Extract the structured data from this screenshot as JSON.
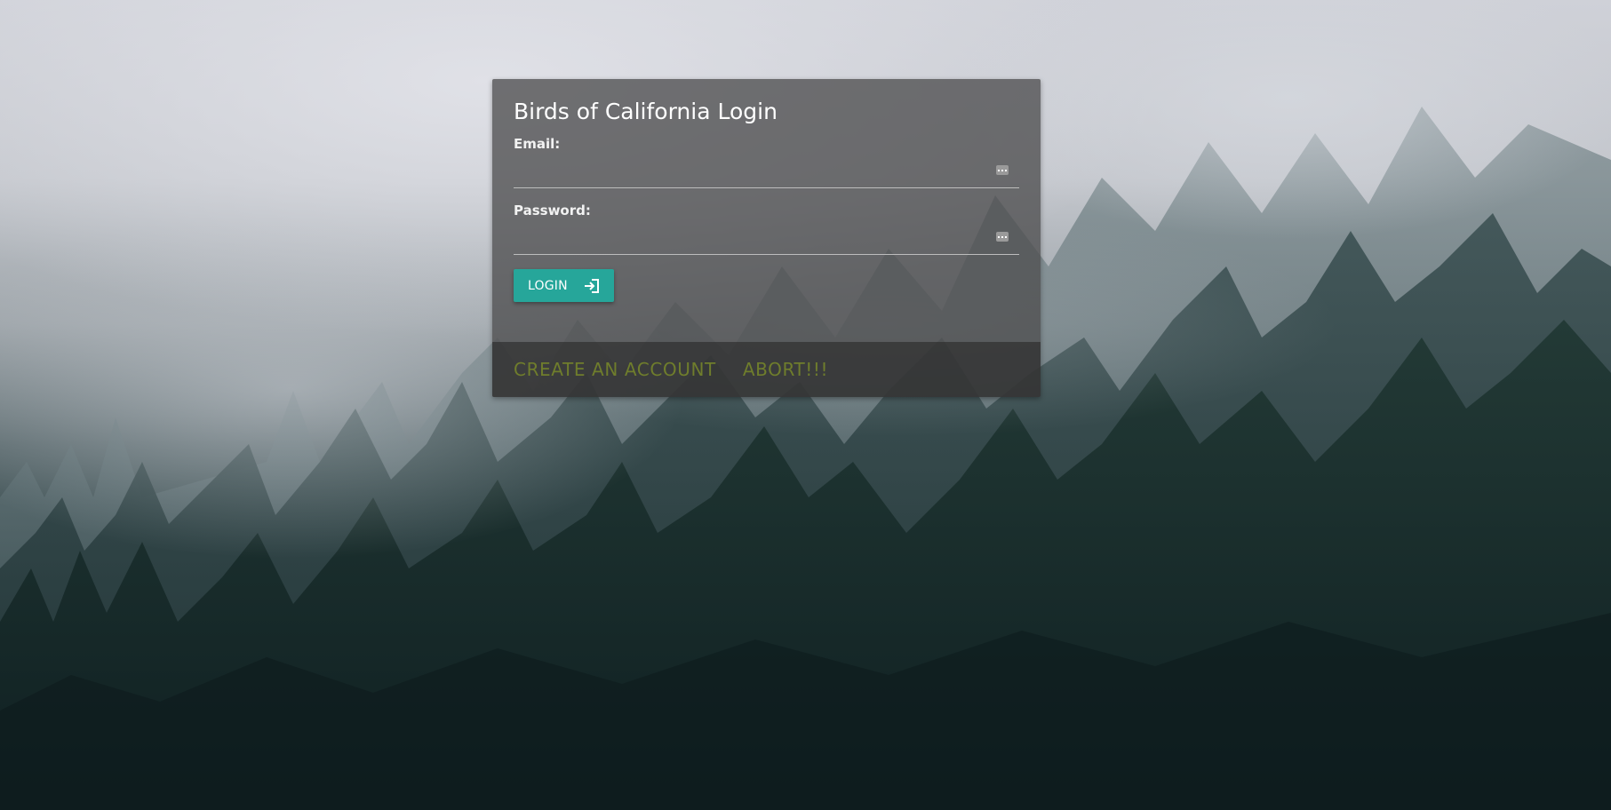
{
  "login_card": {
    "title": "Birds of California Login",
    "email": {
      "label": "Email:",
      "value": "",
      "placeholder": "",
      "icon": "password-manager-key-icon"
    },
    "password": {
      "label": "Password:",
      "value": "",
      "placeholder": "",
      "icon": "password-manager-key-icon"
    },
    "login_button": {
      "label": "LOGIN",
      "icon": "login-enter-icon"
    },
    "actions": {
      "create_account": "CREATE AN ACCOUNT",
      "abort": "ABORT!!!"
    }
  },
  "colors": {
    "button": "#26a69a",
    "action_links": "#6f7d2c",
    "card_background": "#4e4e50"
  },
  "background": {
    "description_icon": "foggy-forest-photo"
  }
}
